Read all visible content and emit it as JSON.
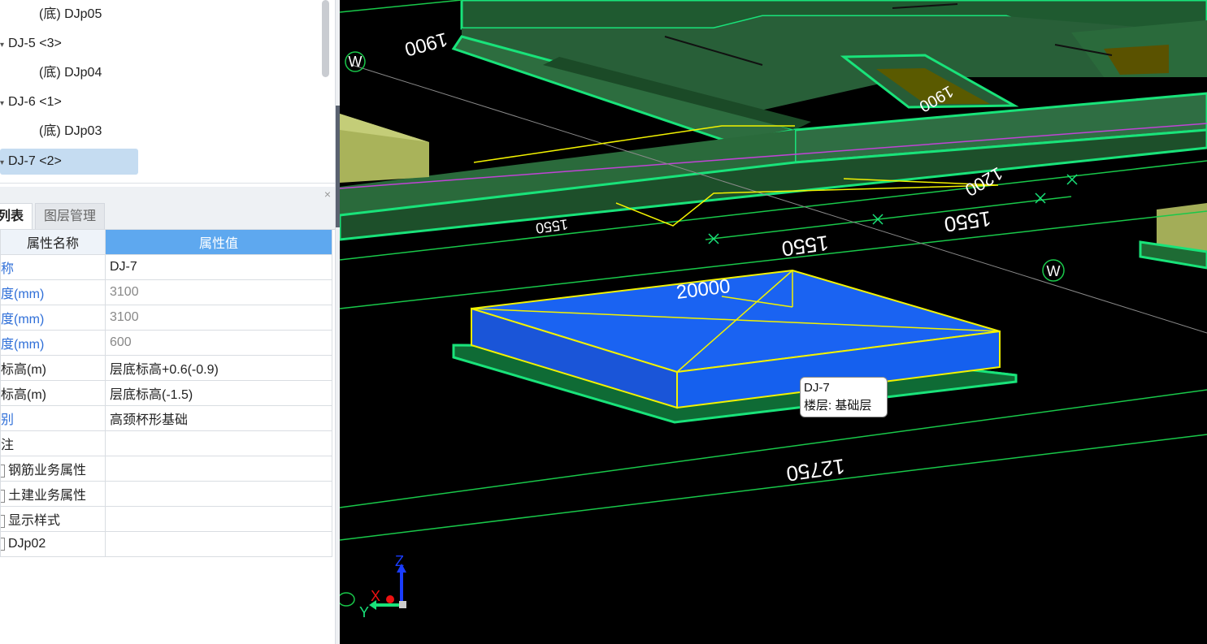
{
  "tree": {
    "items": [
      {
        "label": "(底) DJp05",
        "arrow": "",
        "selected": false
      },
      {
        "label": "DJ-5 <3>",
        "arrow": "▾",
        "selected": false
      },
      {
        "label": "(底) DJp04",
        "arrow": "",
        "selected": false
      },
      {
        "label": "DJ-6 <1>",
        "arrow": "▾",
        "selected": false
      },
      {
        "label": "(底) DJp03",
        "arrow": "",
        "selected": false
      },
      {
        "label": "DJ-7 <2>",
        "arrow": "▾",
        "selected": true
      }
    ]
  },
  "panel": {
    "close": "×",
    "tabs": [
      {
        "label": "列表",
        "active": true
      },
      {
        "label": "图层管理",
        "active": false
      }
    ],
    "headers": {
      "name": "属性名称",
      "value": "属性值"
    },
    "rows": [
      {
        "name": "称",
        "value": "DJ-7"
      },
      {
        "name": "度(mm)",
        "value": "3100"
      },
      {
        "name": "度(mm)",
        "value": "3100"
      },
      {
        "name": "度(mm)",
        "value": "600"
      },
      {
        "name": "标高(m)",
        "value": "层底标高+0.6(-0.9)"
      },
      {
        "name": "标高(m)",
        "value": "层底标高(-1.5)"
      },
      {
        "name": "别",
        "value": "高颈杯形基础"
      },
      {
        "name": "注",
        "value": ""
      },
      {
        "name": "钢筋业务属性",
        "value": ""
      },
      {
        "name": "土建业务属性",
        "value": ""
      },
      {
        "name": "显示样式",
        "value": ""
      },
      {
        "name": "DJp02",
        "value": ""
      }
    ]
  },
  "viewport": {
    "dims": {
      "d1": "1900",
      "d2": "1550",
      "d3": "1550",
      "d4": "1550",
      "d5": "12750",
      "d6": "1200",
      "d7": "20000",
      "d8": "1900"
    },
    "axis_w": "W",
    "axis_labels": {
      "z": "Z",
      "x": "X",
      "y": "Y"
    }
  },
  "tooltip": {
    "line1": "DJ-7",
    "line2": "楼层: 基础层"
  },
  "colors": {
    "accent": "#5ea8ef",
    "green": "#19e37a",
    "yellow": "#f2f200",
    "blue_solid": "#1a63f2"
  }
}
